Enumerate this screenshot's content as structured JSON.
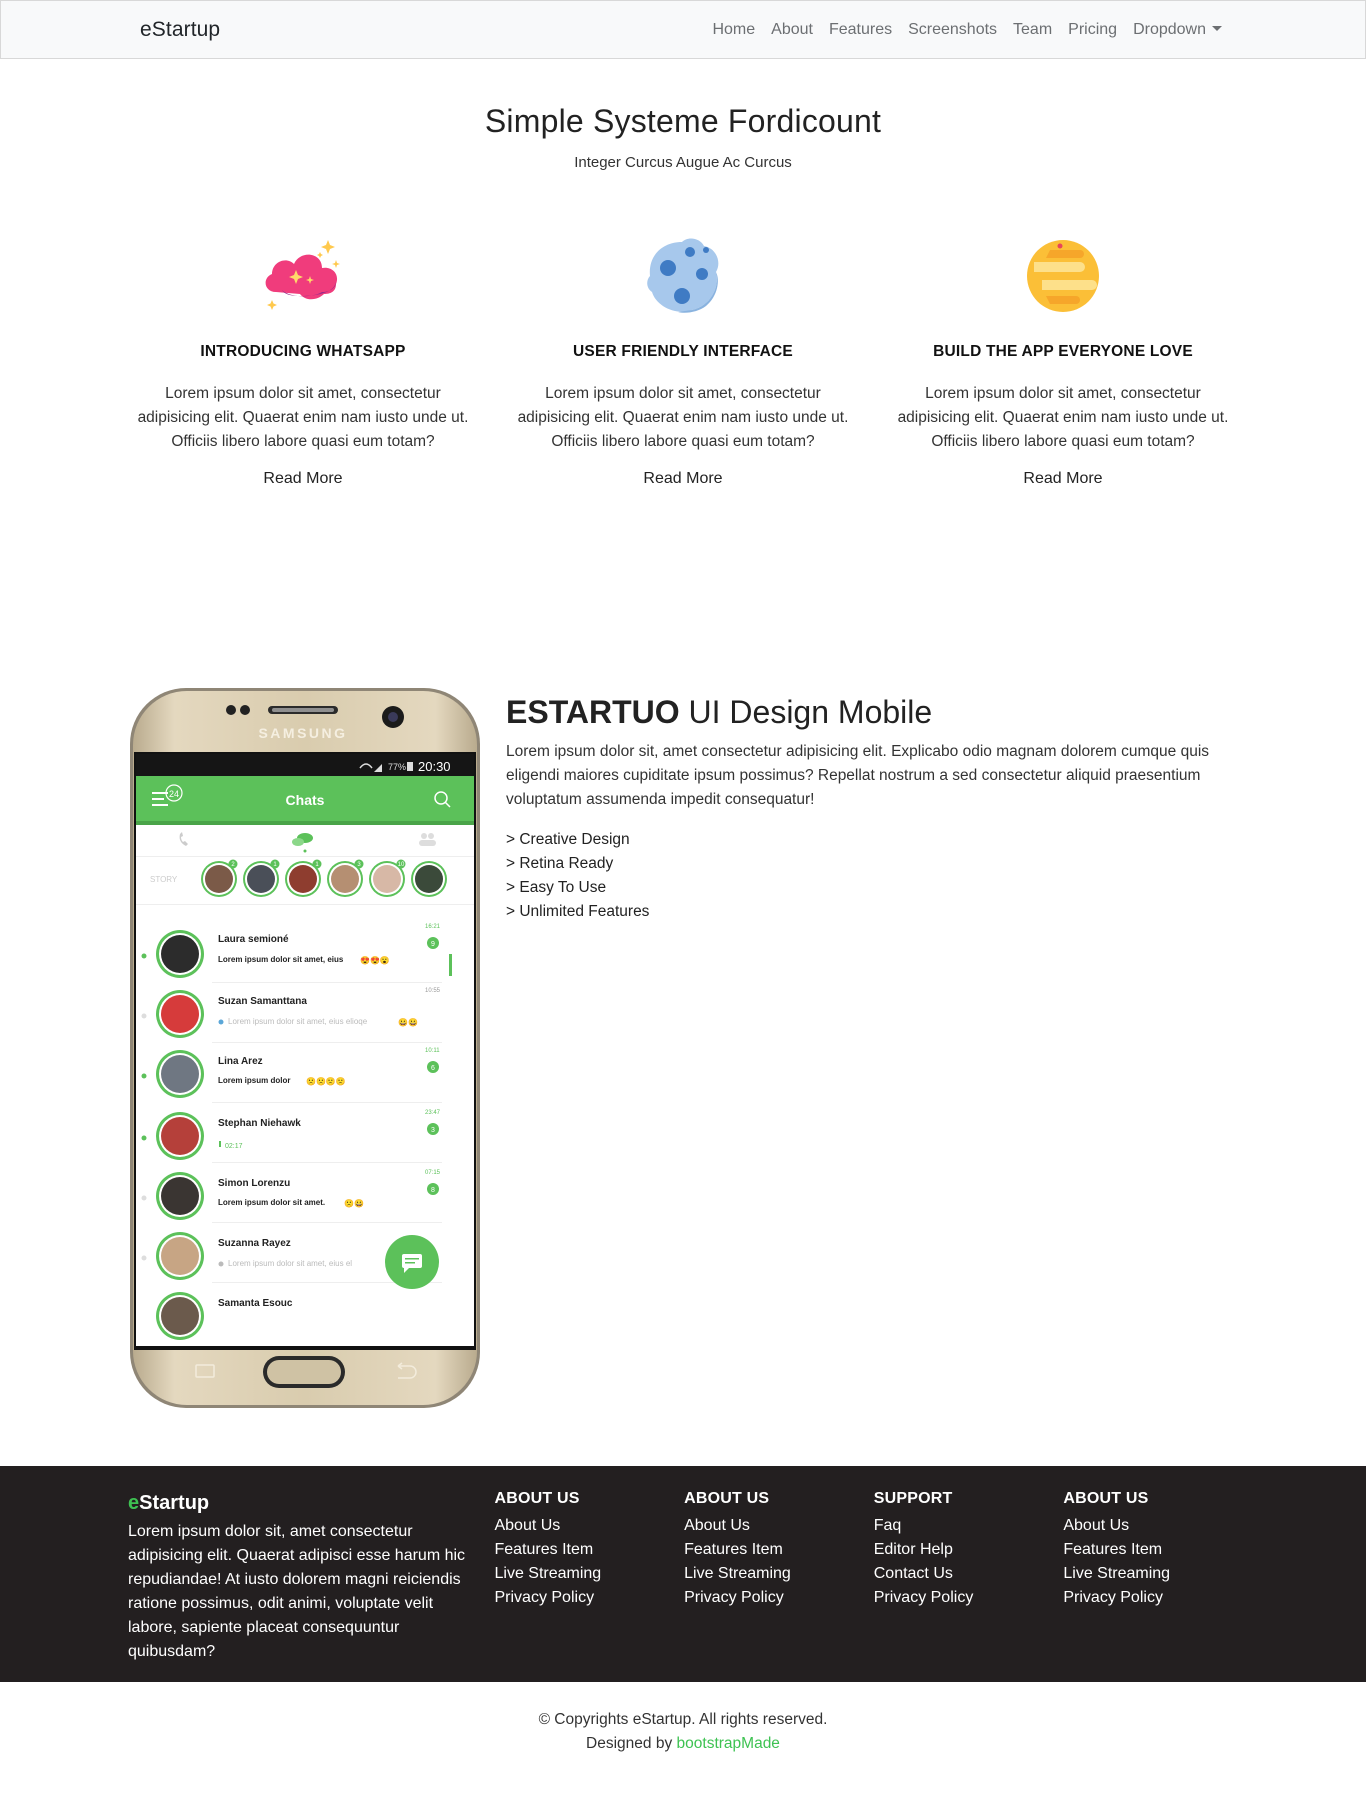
{
  "nav": {
    "brand": "eStartup",
    "links": [
      "Home",
      "About",
      "Features",
      "Screenshots",
      "Team",
      "Pricing",
      "Dropdown"
    ]
  },
  "features": {
    "title": "Simple Systeme Fordicount",
    "subtitle": "Integer Curcus Augue Ac Curcus",
    "cards": [
      {
        "icon": "pink-cloud-icon",
        "heading": "INTRODUCING WHATSAPP",
        "text": "Lorem ipsum dolor sit amet, consectetur adipisicing elit. Quaerat enim nam iusto unde ut. Officiis libero labore quasi eum totam?",
        "link": "Read More"
      },
      {
        "icon": "blue-moon-icon",
        "heading": "USER FRIENDLY INTERFACE",
        "text": "Lorem ipsum dolor sit amet, consectetur adipisicing elit. Quaerat enim nam iusto unde ut. Officiis libero labore quasi eum totam?",
        "link": "Read More"
      },
      {
        "icon": "orange-planet-icon",
        "heading": "BUILD THE APP EVERYONE LOVE",
        "text": "Lorem ipsum dolor sit amet, consectetur adipisicing elit. Quaerat enim nam iusto unde ut. Officiis libero labore quasi eum totam?",
        "link": "Read More"
      }
    ]
  },
  "about": {
    "title_bold": "ESTARTUO",
    "title_rest": " UI Design Mobile",
    "text": "Lorem ipsum dolor sit, amet consectetur adipisicing elit. Explicabo odio magnam dolorem cumque quis eligendi maiores cupiditate ipsum possimus? Repellat nostrum a sed consectetur aliquid praesentium voluptatum assumenda impedit consequatur!",
    "list": [
      "> Creative Design",
      "> Retina Ready",
      "> Easy To Use",
      "> Unlimited Features"
    ]
  },
  "phone": {
    "brand": "SAMSUNG",
    "status_battery": "77%",
    "status_time": "20:30",
    "badge": "24",
    "header": "Chats",
    "story_label": "STORY",
    "story_counts": [
      "2",
      "1",
      "1",
      "3",
      "",
      "10",
      ""
    ],
    "chats": [
      {
        "name": "Laura semioné",
        "msg": "Lorem ipsum dolor sit amet, eius",
        "time": "16:21",
        "count": "9",
        "emoji": "😍😍😮",
        "bold": true
      },
      {
        "name": "Suzan Samanttana",
        "msg": "Lorem ipsum dolor sit amet, eius elioqe",
        "time": "10:55",
        "count": "",
        "emoji": "😀😀",
        "bold": false
      },
      {
        "name": "Lina Arez",
        "msg": "Lorem ipsum dolor",
        "time": "10:11",
        "count": "6",
        "emoji": "🙁🙁🙁🙁",
        "bold": true
      },
      {
        "name": "Stephan Niehawk",
        "msg": "02:17",
        "time": "23:47",
        "count": "3",
        "emoji": "",
        "bold": false
      },
      {
        "name": "Simon Lorenzu",
        "msg": "Lorem ipsum dolor sit amet.",
        "time": "07:15",
        "count": "8",
        "emoji": "🙁😀",
        "bold": true
      },
      {
        "name": "Suzanna Rayez",
        "msg": "Lorem ipsum dolor sit amet, eius el",
        "time": "",
        "count": "",
        "emoji": "",
        "bold": false
      },
      {
        "name": "Samanta Esouc",
        "msg": "",
        "time": "",
        "count": "",
        "emoji": "",
        "bold": false
      }
    ]
  },
  "footer": {
    "brand": "eStartup",
    "about_text": "Lorem ipsum dolor sit, amet consectetur adipisicing elit. Quaerat adipisci esse harum hic repudiandae! At iusto dolorem magni reiciendis ratione possimus, odit animi, voluptate velit labore, sapiente placeat consequuntur quibusdam?",
    "columns": [
      {
        "heading": "ABOUT US",
        "links": [
          "About Us",
          "Features Item",
          "Live Streaming",
          "Privacy Policy"
        ]
      },
      {
        "heading": "ABOUT US",
        "links": [
          "About Us",
          "Features Item",
          "Live Streaming",
          "Privacy Policy"
        ]
      },
      {
        "heading": "SUPPORT",
        "links": [
          "Faq",
          "Editor Help",
          "Contact Us",
          "Privacy Policy"
        ]
      },
      {
        "heading": "ABOUT US",
        "links": [
          "About Us",
          "Features Item",
          "Live Streaming",
          "Privacy Policy"
        ]
      }
    ]
  },
  "copyright": {
    "line1": "© Copyrights eStartup. All rights reserved.",
    "designed_by": "Designed by ",
    "designer": "bootstrapMade"
  },
  "colors": {
    "accent_green": "#3ec252",
    "phone_green": "#5cc15a",
    "footer_bg": "#231f20"
  }
}
